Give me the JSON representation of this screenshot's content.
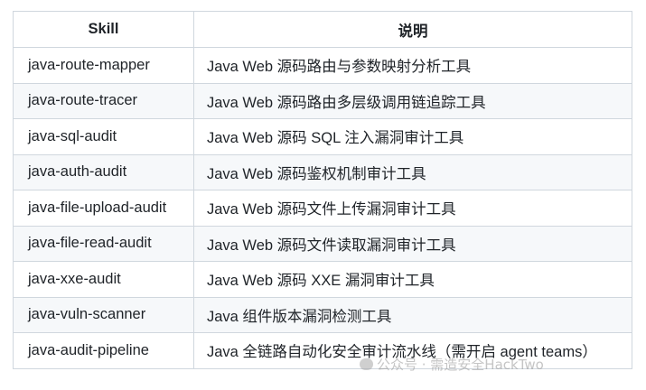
{
  "header": {
    "col1": "Skill",
    "col2": "说明"
  },
  "rows": [
    {
      "skill": "java-route-mapper",
      "desc": "Java Web 源码路由与参数映射分析工具"
    },
    {
      "skill": "java-route-tracer",
      "desc": "Java Web 源码路由多层级调用链追踪工具"
    },
    {
      "skill": "java-sql-audit",
      "desc": "Java Web 源码 SQL 注入漏洞审计工具"
    },
    {
      "skill": "java-auth-audit",
      "desc": "Java Web 源码鉴权机制审计工具"
    },
    {
      "skill": "java-file-upload-audit",
      "desc": "Java Web 源码文件上传漏洞审计工具"
    },
    {
      "skill": "java-file-read-audit",
      "desc": "Java Web 源码文件读取漏洞审计工具"
    },
    {
      "skill": "java-xxe-audit",
      "desc": "Java Web 源码 XXE 漏洞审计工具"
    },
    {
      "skill": "java-vuln-scanner",
      "desc": "Java 组件版本漏洞检测工具"
    },
    {
      "skill": "java-audit-pipeline",
      "desc": "Java 全链路自动化安全审计流水线（需开启 agent teams）"
    }
  ],
  "watermark": {
    "text": "公众号 · 需造安全HackTwo",
    "icon": "wechat-icon"
  }
}
